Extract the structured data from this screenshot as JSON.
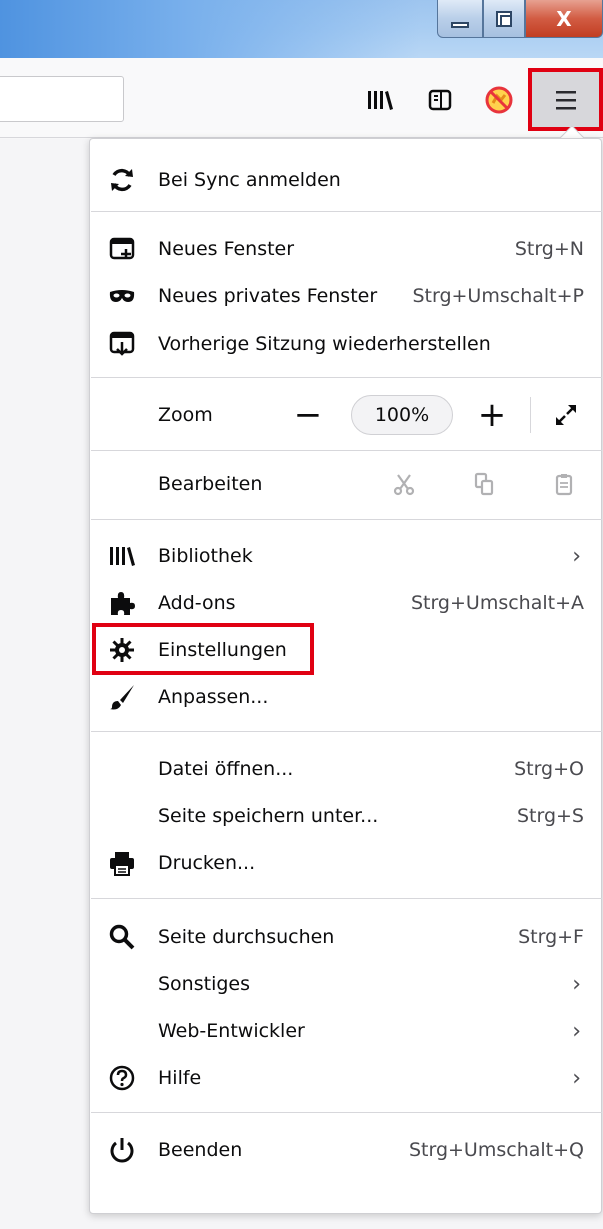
{
  "window": {
    "minimize_icon": "minimize-icon",
    "maximize_icon": "restore-icon",
    "close_glyph": "X"
  },
  "toolbar": {
    "library_icon": "library-icon",
    "sidebar_icon": "sidebar-icon",
    "extension_icon": "blocked-extension-icon",
    "menu_icon": "hamburger-menu-icon"
  },
  "menu": {
    "sync": {
      "label": "Bei Sync anmelden",
      "icon": "sync-icon"
    },
    "new_window": {
      "label": "Neues Fenster",
      "shortcut": "Strg+N",
      "icon": "new-window-icon"
    },
    "private_window": {
      "label": "Neues privates Fenster",
      "shortcut": "Strg+Umschalt+P",
      "icon": "private-mask-icon"
    },
    "restore_session": {
      "label": "Vorherige Sitzung wiederherstellen",
      "icon": "restore-session-icon"
    },
    "zoom": {
      "label": "Zoom",
      "minus": "−",
      "value": "100%",
      "plus": "+",
      "fullscreen_icon": "fullscreen-icon"
    },
    "edit": {
      "label": "Bearbeiten",
      "cut_icon": "cut-icon",
      "copy_icon": "copy-icon",
      "paste_icon": "paste-icon"
    },
    "library": {
      "label": "Bibliothek",
      "chevron": "›",
      "icon": "library-icon"
    },
    "addons": {
      "label": "Add-ons",
      "shortcut": "Strg+Umschalt+A",
      "icon": "puzzle-icon"
    },
    "settings": {
      "label": "Einstellungen",
      "icon": "gear-icon"
    },
    "customize": {
      "label": "Anpassen...",
      "icon": "brush-icon"
    },
    "open_file": {
      "label": "Datei öffnen...",
      "shortcut": "Strg+O"
    },
    "save_page": {
      "label": "Seite speichern unter...",
      "shortcut": "Strg+S"
    },
    "print": {
      "label": "Drucken...",
      "icon": "printer-icon"
    },
    "find": {
      "label": "Seite durchsuchen",
      "shortcut": "Strg+F",
      "icon": "search-icon"
    },
    "more": {
      "label": "Sonstiges",
      "chevron": "›"
    },
    "web_dev": {
      "label": "Web-Entwickler",
      "chevron": "›"
    },
    "help": {
      "label": "Hilfe",
      "chevron": "›",
      "icon": "help-icon"
    },
    "quit": {
      "label": "Beenden",
      "shortcut": "Strg+Umschalt+Q",
      "icon": "power-icon"
    }
  },
  "colors": {
    "highlight": "#e00012",
    "menu_text": "#0c0c0d",
    "shortcut_text": "#4a4a4f"
  }
}
